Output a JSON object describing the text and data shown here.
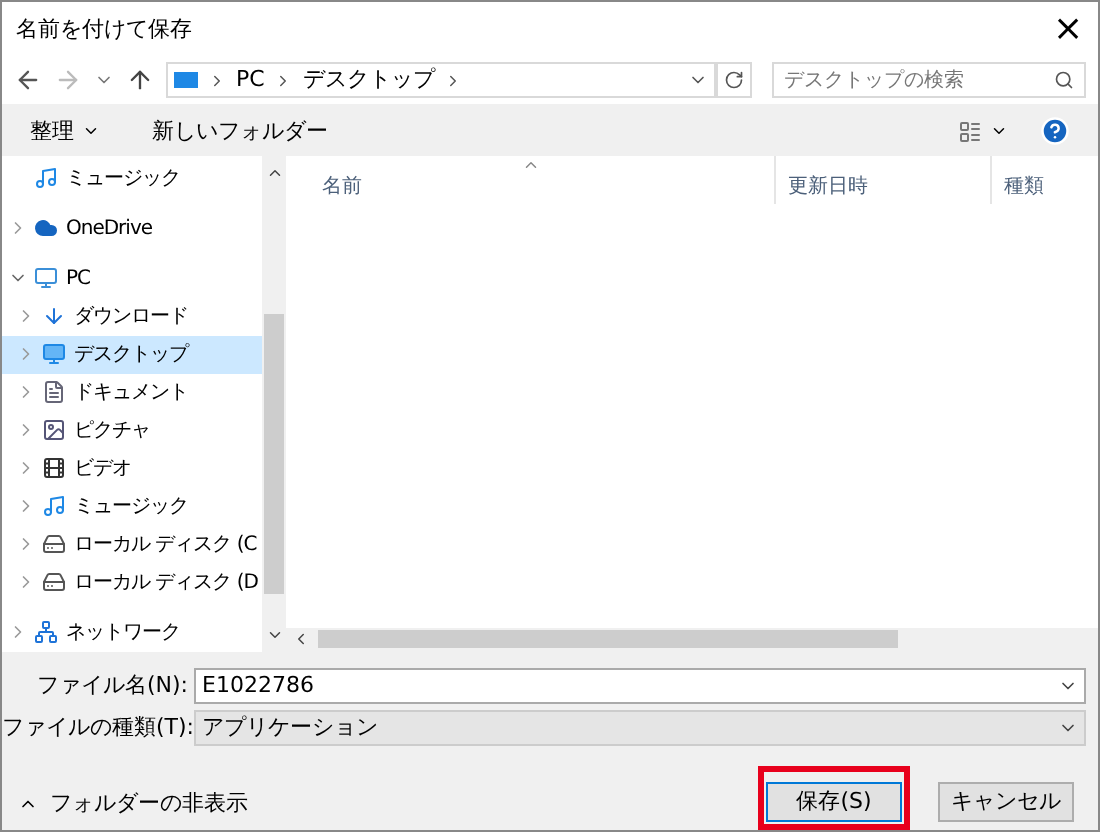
{
  "window": {
    "title": "名前を付けて保存",
    "close": "×"
  },
  "address": {
    "segments": [
      "PC",
      "デスクトップ"
    ],
    "search_placeholder": "デスクトップの検索"
  },
  "toolbar": {
    "organize": "整理",
    "new_folder": "新しいフォルダー"
  },
  "sidebar": {
    "items": [
      {
        "label": "ミュージック",
        "kind": "music",
        "selected": false
      },
      {
        "label": "OneDrive",
        "kind": "cloud",
        "selected": false,
        "expanded": false
      },
      {
        "label": "PC",
        "kind": "pc",
        "selected": false,
        "expanded": true,
        "children": [
          {
            "label": "ダウンロード",
            "kind": "download",
            "selected": false,
            "expanded": false
          },
          {
            "label": "デスクトップ",
            "kind": "desktop",
            "selected": true,
            "expanded": false
          },
          {
            "label": "ドキュメント",
            "kind": "document",
            "selected": false,
            "expanded": false
          },
          {
            "label": "ピクチャ",
            "kind": "picture",
            "selected": false,
            "expanded": false
          },
          {
            "label": "ビデオ",
            "kind": "video",
            "selected": false,
            "expanded": false
          },
          {
            "label": "ミュージック",
            "kind": "music",
            "selected": false,
            "expanded": false
          },
          {
            "label": "ローカル ディスク (C",
            "kind": "drive",
            "selected": false,
            "expanded": false
          },
          {
            "label": "ローカル ディスク (D",
            "kind": "drive",
            "selected": false,
            "expanded": false
          }
        ]
      },
      {
        "label": "ネットワーク",
        "kind": "network",
        "selected": false,
        "expanded": false
      }
    ]
  },
  "table": {
    "columns": [
      "名前",
      "更新日時",
      "種類"
    ]
  },
  "form": {
    "filename_label": "ファイル名(N):",
    "filename": "E1022786",
    "type_label": "ファイルの種類(T):",
    "type": "アプリケーション"
  },
  "footer": {
    "hide_folders": "フォルダーの非表示",
    "buttons": [
      {
        "label": "保存(S)",
        "highlighted": true
      },
      {
        "label": "キャンセル",
        "highlighted": false
      }
    ]
  }
}
